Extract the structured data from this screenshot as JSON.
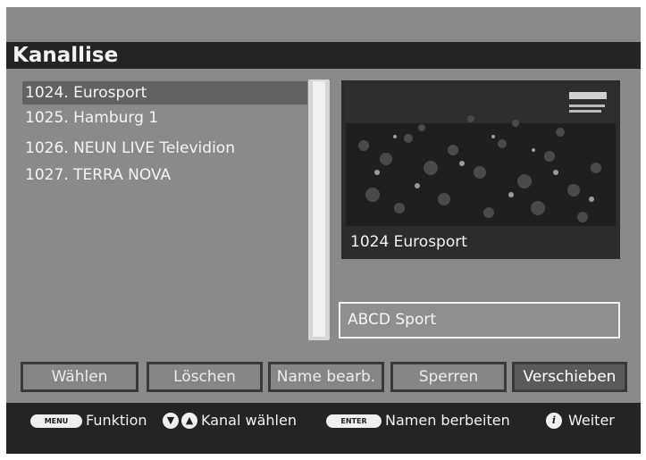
{
  "header": {
    "title": "Kanallise"
  },
  "channels": [
    {
      "label": "1024. Eurosport",
      "selected": true
    },
    {
      "label": "1025. Hamburg 1",
      "selected": false
    },
    {
      "label": "1026. NEUN LIVE Televidion",
      "selected": false
    },
    {
      "label": "1027. TERRA NOVA",
      "selected": false
    }
  ],
  "preview": {
    "caption": "1024 Eurosport",
    "image": "stadium-crowd-broadcast",
    "logo": "eurosport-logo"
  },
  "name_field": {
    "value": "ABCD Sport"
  },
  "buttons": [
    {
      "label": "Wählen",
      "active": false
    },
    {
      "label": "Löschen",
      "active": false
    },
    {
      "label": "Name bearb.",
      "active": false
    },
    {
      "label": "Sperren",
      "active": false
    },
    {
      "label": "Verschieben",
      "active": true
    }
  ],
  "footer": {
    "menu_key": "MENU",
    "menu_text": "Funktion",
    "arrow_icons": [
      "arrow-down-icon",
      "arrow-up-icon"
    ],
    "arrows_text": "Kanal wählen",
    "enter_key": "ENTER",
    "enter_text": "Namen berbeiten",
    "info_key": "i",
    "info_text": "Weiter"
  },
  "colors": {
    "background": "#8a8a8a",
    "bars": "#242424",
    "selection": "#626262",
    "text": "#f4f4f4"
  }
}
